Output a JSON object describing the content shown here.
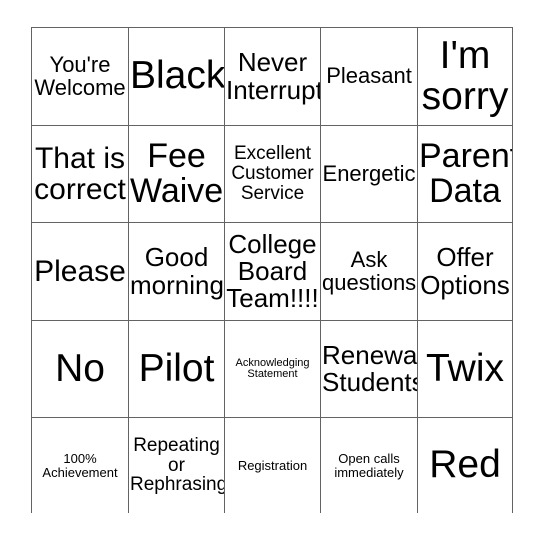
{
  "card": {
    "type": "bingo-card",
    "columns": 5,
    "rows": 5,
    "border_color": "#636363",
    "background_color": "#ffffff",
    "text_color": "#000000",
    "cells": [
      [
        {
          "text": "You're\nWelcome",
          "size": "sm"
        },
        {
          "text": "Black",
          "size": "xxl"
        },
        {
          "text": "Never\nInterrupt",
          "size": "md"
        },
        {
          "text": "Pleasant",
          "size": "sm"
        },
        {
          "text": "I'm\nsorry",
          "size": "xxl"
        }
      ],
      [
        {
          "text": "That is\ncorrect",
          "size": "lg"
        },
        {
          "text": "Fee\nWaiver",
          "size": "xl"
        },
        {
          "text": "Excellent\nCustomer\nService",
          "size": "xs"
        },
        {
          "text": "Energetic",
          "size": "sm"
        },
        {
          "text": "Parent\nData",
          "size": "xl"
        }
      ],
      [
        {
          "text": "Please",
          "size": "lg"
        },
        {
          "text": "Good\nmorning",
          "size": "md"
        },
        {
          "text": "College\nBoard\nTeam!!!!",
          "size": "md"
        },
        {
          "text": "Ask\nquestions",
          "size": "sm"
        },
        {
          "text": "Offer\nOptions",
          "size": "md"
        }
      ],
      [
        {
          "text": "No",
          "size": "xxl"
        },
        {
          "text": "Pilot",
          "size": "xxl"
        },
        {
          "text": "Acknowledging\nStatement",
          "size": "tiny"
        },
        {
          "text": "Renewal\nStudents",
          "size": "md"
        },
        {
          "text": "Twix",
          "size": "xxl"
        }
      ],
      [
        {
          "text": "100%\nAchievement",
          "size": "xxs"
        },
        {
          "text": "Repeating\nor\nRephrasing",
          "size": "xs"
        },
        {
          "text": "Registration",
          "size": "xxs"
        },
        {
          "text": "Open calls\nimmediately",
          "size": "xxs"
        },
        {
          "text": "Red",
          "size": "xxl"
        }
      ]
    ]
  }
}
